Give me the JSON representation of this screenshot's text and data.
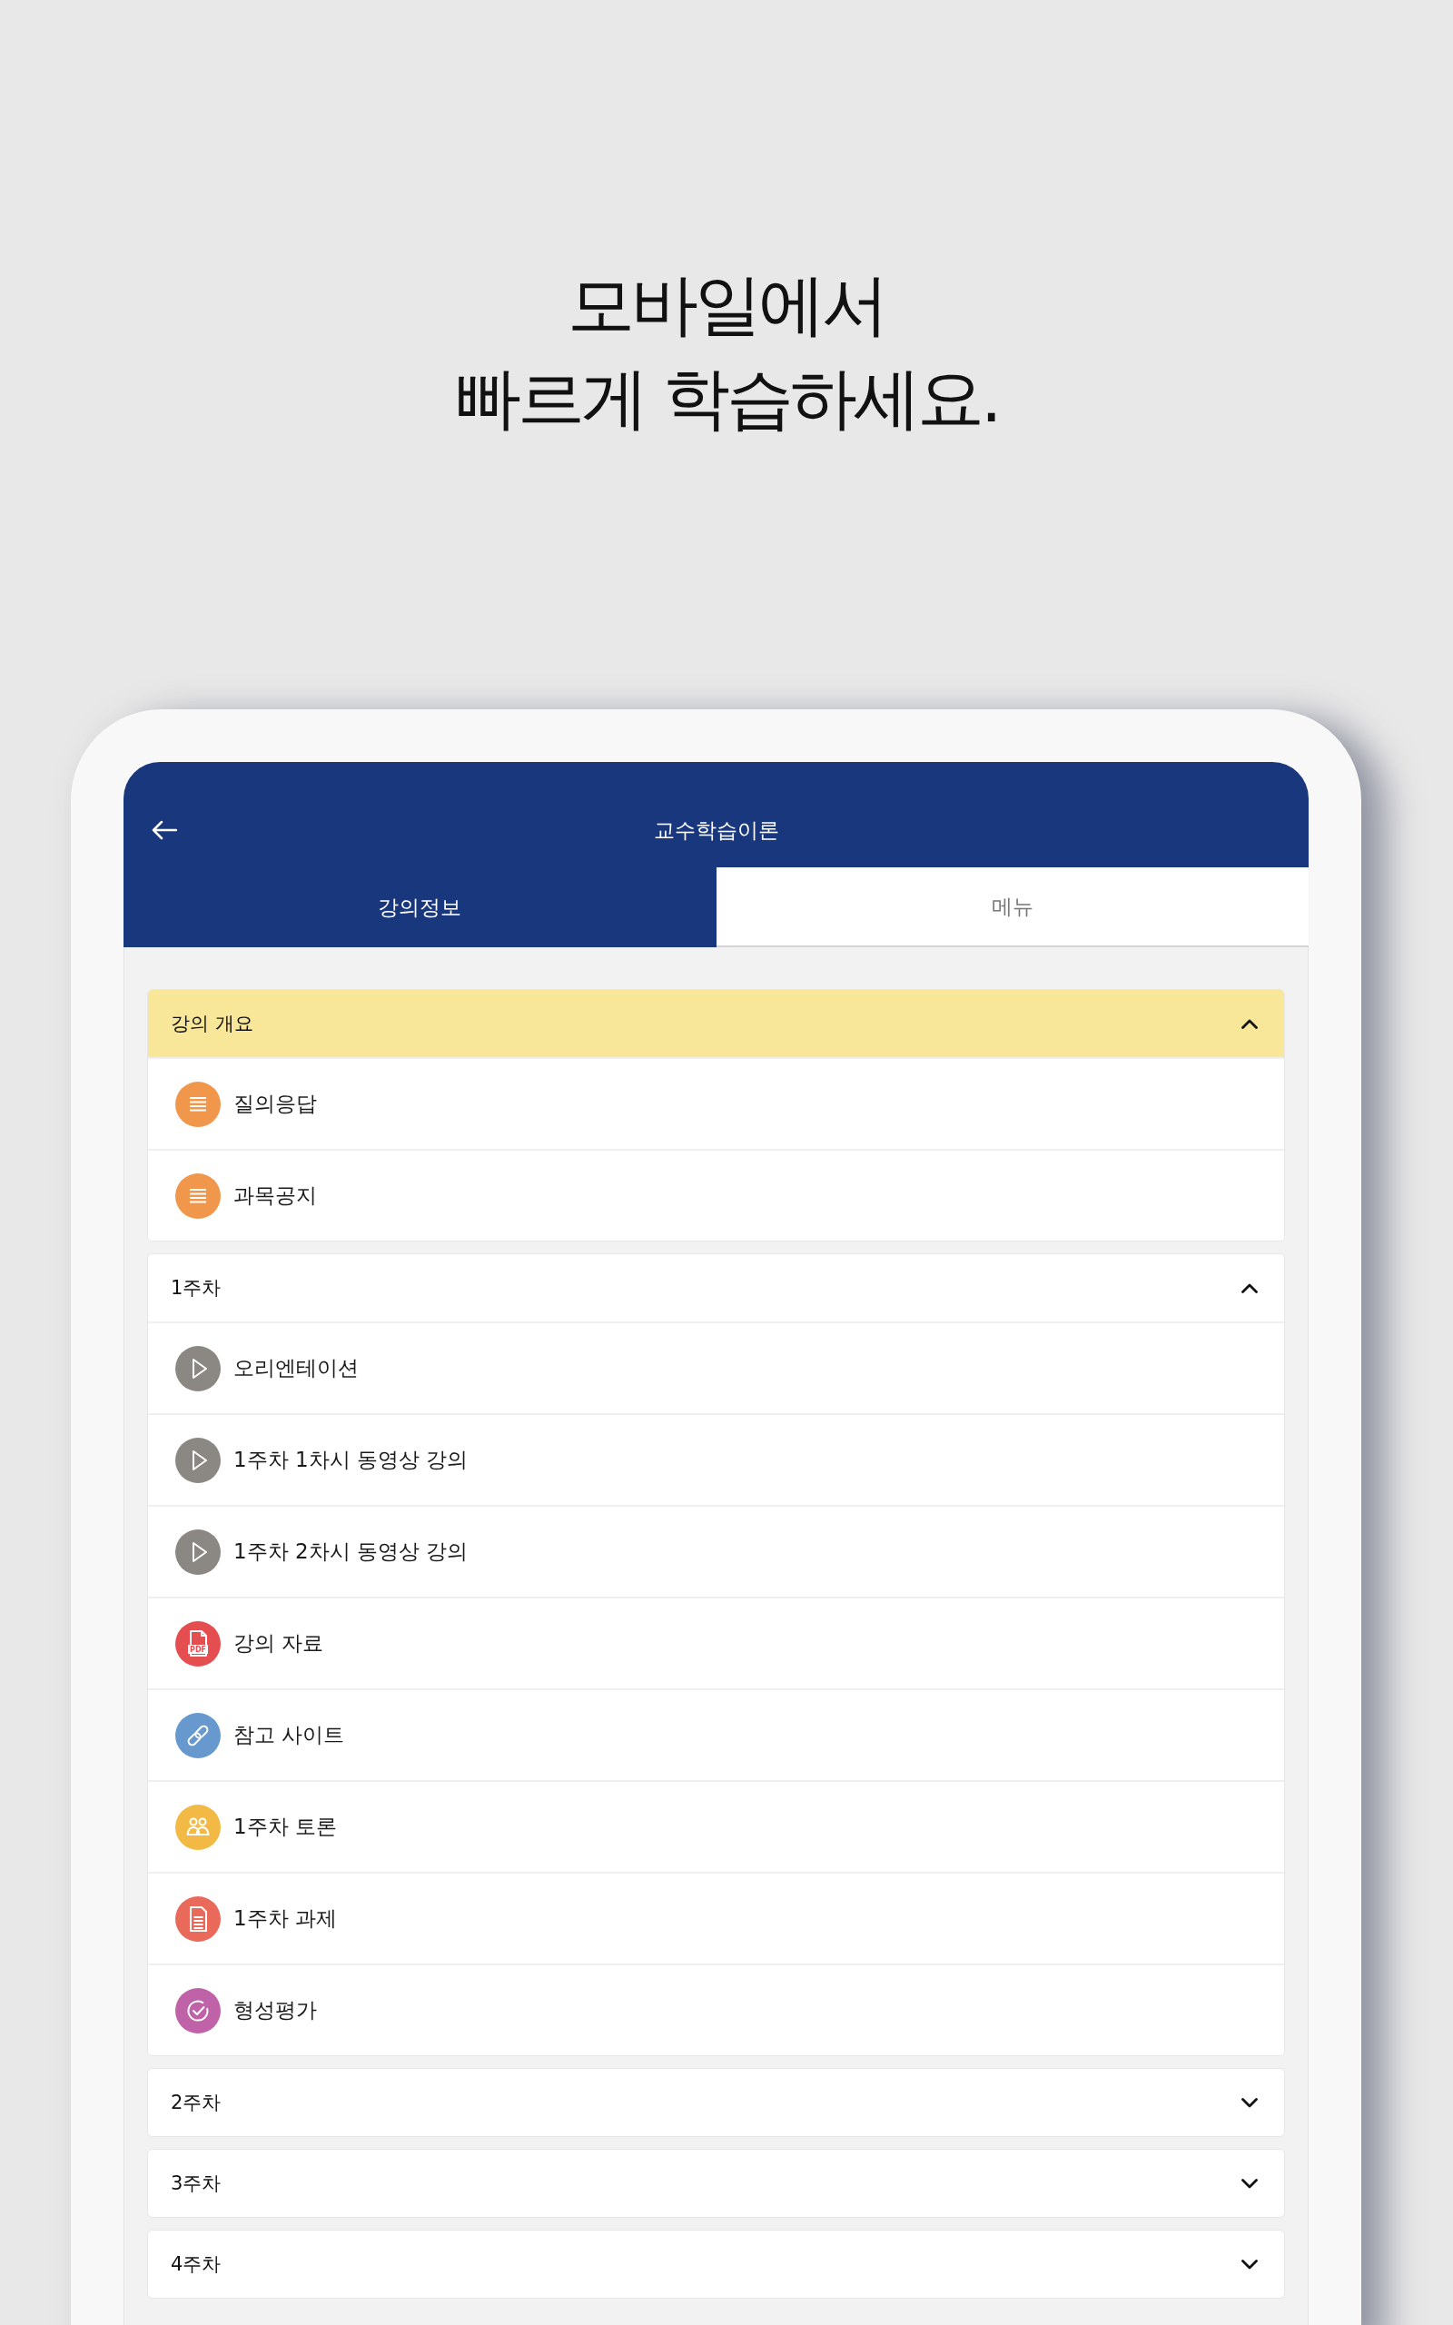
{
  "headline": {
    "lines": [
      "모바일에서",
      "빠르게 학습하세요."
    ]
  },
  "header": {
    "title": "교수학습이론"
  },
  "tabs": [
    {
      "label": "강의정보",
      "selected": true
    },
    {
      "label": "메뉴",
      "selected": false
    }
  ],
  "sections": [
    {
      "title": "강의 개요",
      "selected": true,
      "expanded": true,
      "items": [
        {
          "kind": "board",
          "label": "질의응답"
        },
        {
          "kind": "board",
          "label": "과목공지"
        }
      ]
    },
    {
      "title": "1주차",
      "selected": false,
      "expanded": true,
      "items": [
        {
          "kind": "video",
          "label": "오리엔테이션"
        },
        {
          "kind": "video",
          "label": "1주차 1차시 동영상 강의"
        },
        {
          "kind": "video",
          "label": "1주차 2차시 동영상 강의"
        },
        {
          "kind": "pdf",
          "label": "강의 자료",
          "icon_text": "PDF"
        },
        {
          "kind": "link",
          "label": "참고 사이트"
        },
        {
          "kind": "discussion",
          "label": "1주차 토론"
        },
        {
          "kind": "assignment",
          "label": "1주차 과제"
        },
        {
          "kind": "quiz",
          "label": "형성평가"
        }
      ]
    },
    {
      "title": "2주차",
      "selected": false,
      "expanded": false
    },
    {
      "title": "3주차",
      "selected": false,
      "expanded": false
    },
    {
      "title": "4주차",
      "selected": false,
      "expanded": false
    }
  ]
}
